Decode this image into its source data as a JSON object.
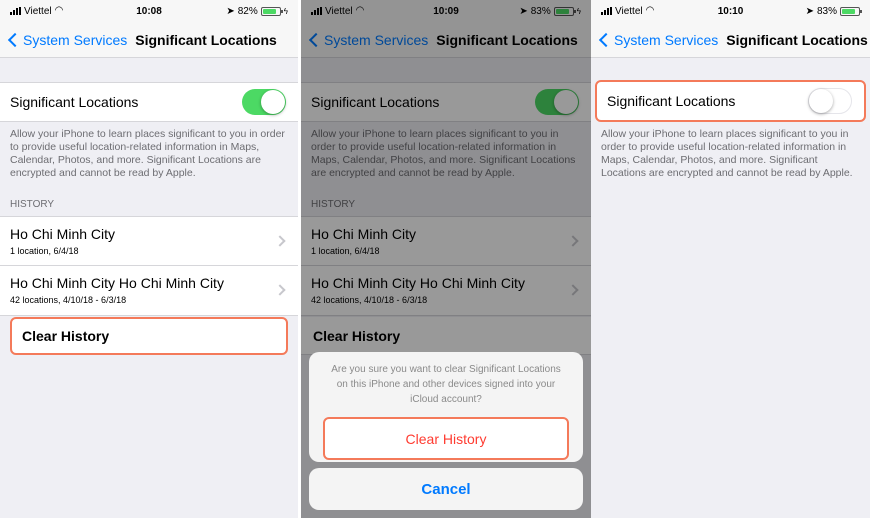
{
  "panels": [
    {
      "status": {
        "carrier": "Viettel",
        "time": "10:08",
        "battery": "82%",
        "battery_level": 0.82
      },
      "nav": {
        "back_label": "System Services",
        "title": "Significant Locations"
      },
      "toggle": {
        "label": "Significant Locations",
        "on": true
      },
      "description": "Allow your iPhone to learn places significant to you in order to provide useful location-related information in Maps, Calendar, Photos, and more. Significant Locations are encrypted and cannot be read by Apple.",
      "section_header": "HISTORY",
      "history": [
        {
          "title": "Ho Chi Minh City",
          "subtitle": "1 location, 6/4/18"
        },
        {
          "title": "Ho Chi Minh City Ho Chi Minh City",
          "subtitle": "42 locations, 4/10/18 - 6/3/18"
        }
      ],
      "clear_label": "Clear History"
    },
    {
      "status": {
        "carrier": "Viettel",
        "time": "10:09",
        "battery": "83%",
        "battery_level": 0.83
      },
      "nav": {
        "back_label": "System Services",
        "title": "Significant Locations"
      },
      "toggle": {
        "label": "Significant Locations",
        "on": true
      },
      "description": "Allow your iPhone to learn places significant to you in order to provide useful location-related information in Maps, Calendar, Photos, and more. Significant Locations are encrypted and cannot be read by Apple.",
      "section_header": "HISTORY",
      "history": [
        {
          "title": "Ho Chi Minh City",
          "subtitle": "1 location, 6/4/18"
        },
        {
          "title": "Ho Chi Minh City Ho Chi Minh City",
          "subtitle": "42 locations, 4/10/18 - 6/3/18"
        }
      ],
      "clear_label": "Clear History",
      "alert": {
        "message": "Are you sure you want to clear Significant Locations on this iPhone and other devices signed into your iCloud account?",
        "confirm_label": "Clear History",
        "cancel_label": "Cancel"
      }
    },
    {
      "status": {
        "carrier": "Viettel",
        "time": "10:10",
        "battery": "83%",
        "battery_level": 0.83
      },
      "nav": {
        "back_label": "System Services",
        "title": "Significant Locations"
      },
      "toggle": {
        "label": "Significant Locations",
        "on": false
      },
      "description": "Allow your iPhone to learn places significant to you in order to provide useful location-related information in Maps, Calendar, Photos, and more. Significant Locations are encrypted and cannot be read by Apple."
    }
  ],
  "colors": {
    "ios_blue": "#007aff",
    "switch_green": "#4cd964",
    "destructive_red": "#ff3b30",
    "highlight_orange": "#f47a5a"
  }
}
